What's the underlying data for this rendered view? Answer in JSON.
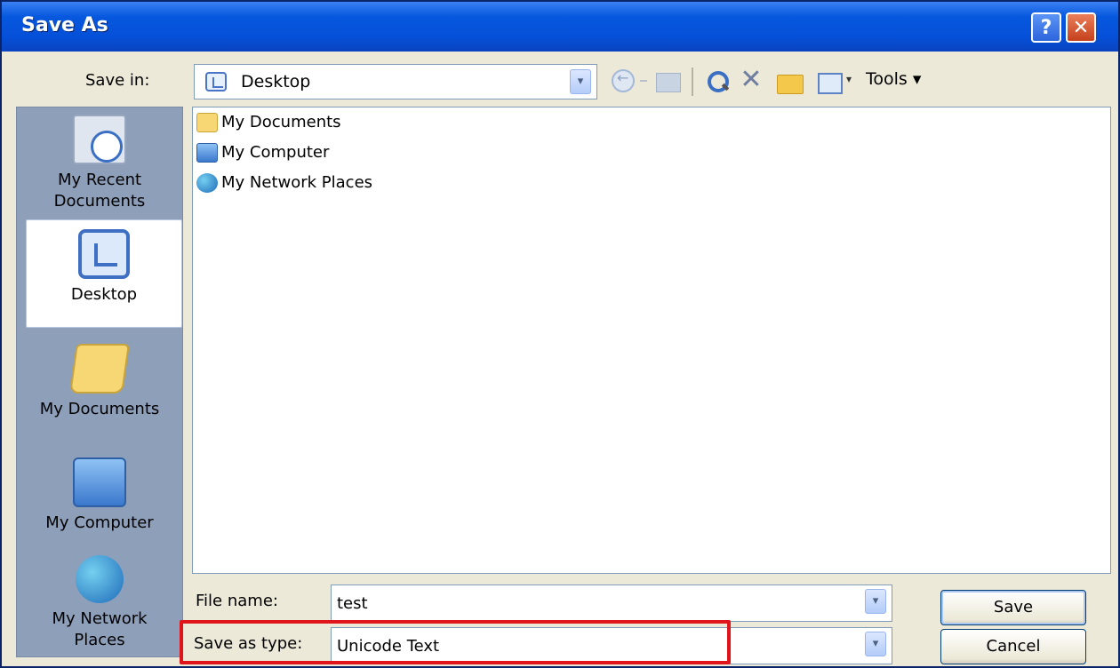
{
  "window": {
    "title": "Save As",
    "help_label": "?",
    "close_label": "✕"
  },
  "toolbar": {
    "save_in_label": "Save in:",
    "save_in_value": "Desktop",
    "dropdown_glyph": "▾",
    "tools_label": "Tools ▾",
    "icons": [
      "back-icon",
      "up-folder-icon",
      "search-web-icon",
      "delete-icon",
      "new-folder-icon",
      "views-icon"
    ]
  },
  "places": [
    {
      "label": "My Recent Documents",
      "icon": "recent-documents-icon"
    },
    {
      "label": "Desktop",
      "icon": "desktop-icon",
      "selected": true
    },
    {
      "label": "My Documents",
      "icon": "my-documents-icon"
    },
    {
      "label": "My Computer",
      "icon": "my-computer-icon"
    },
    {
      "label": "My Network Places",
      "icon": "network-places-icon"
    }
  ],
  "files": [
    {
      "name": "My Documents",
      "icon": "folder-icon"
    },
    {
      "name": "My Computer",
      "icon": "computer-icon"
    },
    {
      "name": "My Network Places",
      "icon": "network-icon"
    }
  ],
  "form": {
    "file_name_label": "File name:",
    "file_name_value": "test",
    "save_type_label": "Save as type:",
    "save_type_value": "Unicode Text"
  },
  "buttons": {
    "save": "Save",
    "cancel": "Cancel"
  },
  "colors": {
    "titlebar": "#0758de",
    "dialog_bg": "#ece9d8",
    "highlight": "#e0141b"
  }
}
